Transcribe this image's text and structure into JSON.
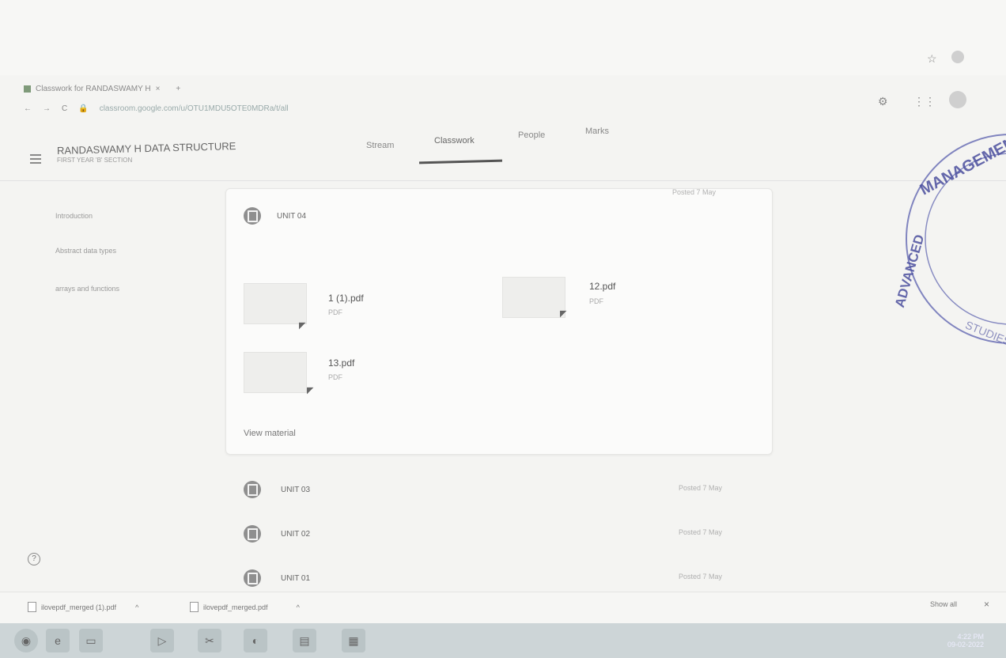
{
  "browser": {
    "tab_title": "Classwork for RANDASWAMY H",
    "tab_close": "×",
    "new_tab": "+",
    "url": "classroom.google.com/u/OTU1MDU5OTE0MDRa/t/all"
  },
  "header": {
    "course_title": "RANDASWAMY H DATA STRUCTURE",
    "course_subtitle": "FIRST YEAR 'B' SECTION",
    "tabs": [
      {
        "label": "Stream"
      },
      {
        "label": "Classwork"
      },
      {
        "label": "People"
      },
      {
        "label": "Marks"
      }
    ],
    "active_tab": "Classwork"
  },
  "sidebar": {
    "items": [
      {
        "label": "Introduction"
      },
      {
        "label": "Abstract data types"
      },
      {
        "label": "arrays and functions"
      }
    ]
  },
  "units": [
    {
      "title": "UNIT 04",
      "posted": "Posted 7 May",
      "files": [
        {
          "name": "1 (1).pdf",
          "type": "PDF"
        },
        {
          "name": "12.pdf",
          "type": "PDF"
        },
        {
          "name": "13.pdf",
          "type": "PDF"
        }
      ],
      "view_label": "View material"
    },
    {
      "title": "UNIT 03",
      "posted": "Posted 7 May"
    },
    {
      "title": "UNIT 02",
      "posted": "Posted 7 May"
    },
    {
      "title": "UNIT 01",
      "posted": "Posted 7 May"
    }
  ],
  "downloads": {
    "items": [
      {
        "name": "ilovepdf_merged (1).pdf"
      },
      {
        "name": "ilovepdf_merged.pdf"
      }
    ],
    "show_all": "Show all",
    "close": "×"
  },
  "help": {
    "icon": "?"
  },
  "stamp": {
    "text_top": "MANAGEMENT",
    "text_left": "ADVANCED",
    "text_bottom": "STUDIES"
  },
  "taskbar": {
    "time": "4:22 PM",
    "date": "09-02-2022"
  }
}
